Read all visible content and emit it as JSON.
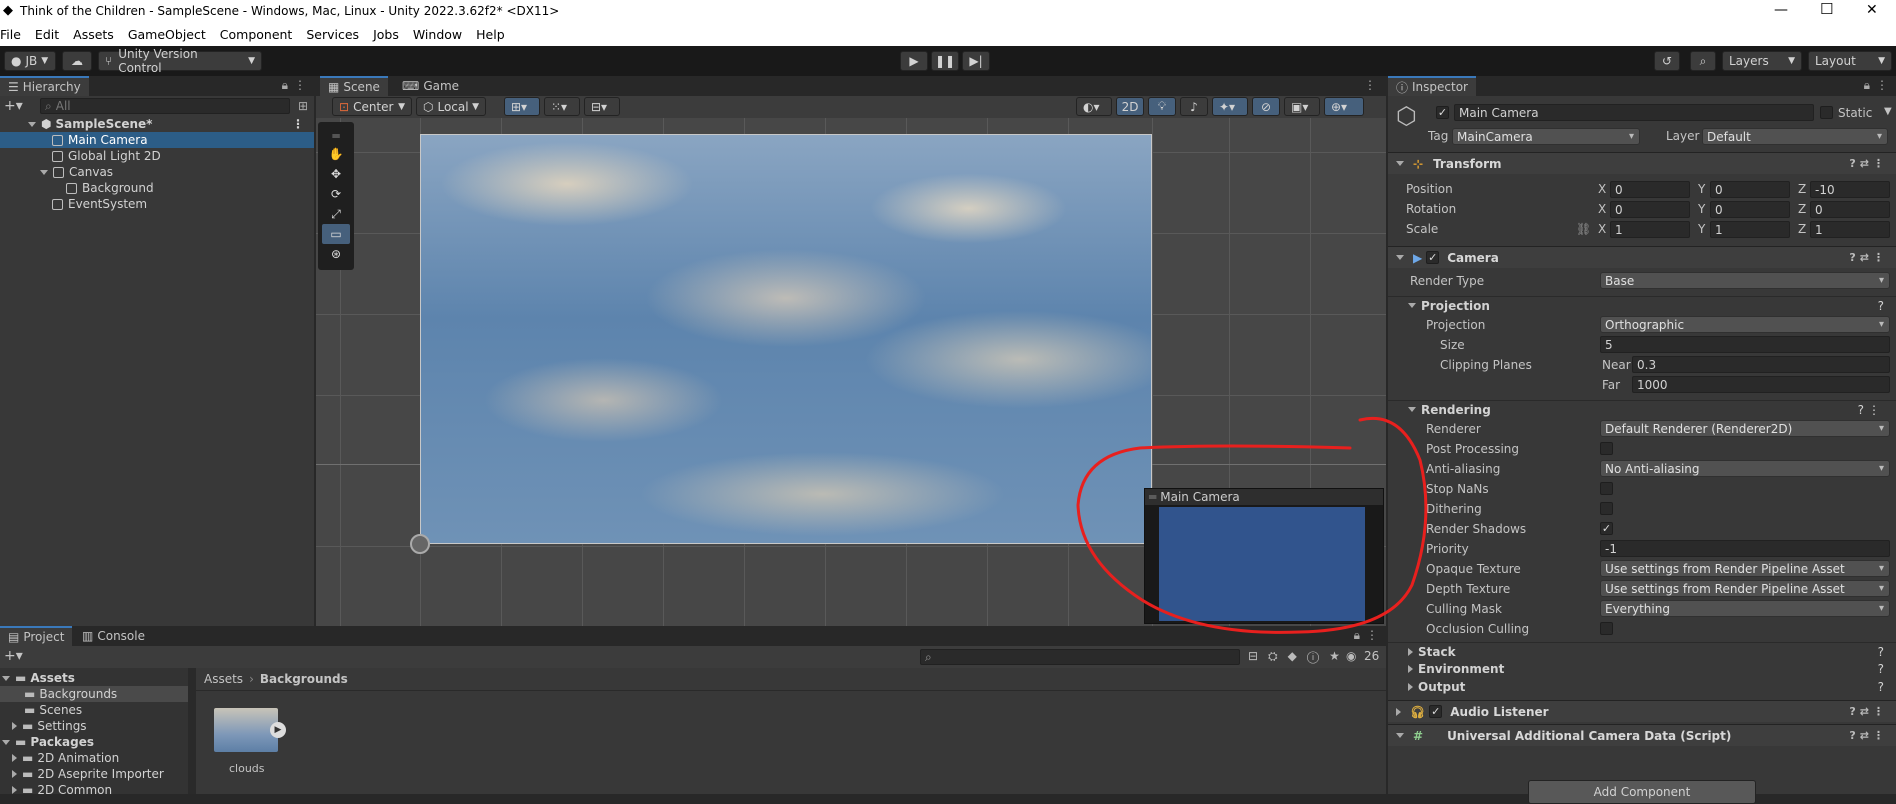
{
  "window": {
    "title": "Think of the Children - SampleScene - Windows, Mac, Linux - Unity 2022.3.62f2* <DX11>"
  },
  "menu": [
    "File",
    "Edit",
    "Assets",
    "GameObject",
    "Component",
    "Services",
    "Jobs",
    "Window",
    "Help"
  ],
  "toolbar": {
    "account": "JB",
    "version_control": "Unity Version Control",
    "layers": "Layers",
    "layout": "Layout"
  },
  "hierarchy": {
    "tab": "Hierarchy",
    "search_placeholder": "All",
    "scene": "SampleScene*",
    "items": [
      "Main Camera",
      "Global Light 2D",
      "Canvas",
      "Background",
      "EventSystem"
    ]
  },
  "scene_view": {
    "tabs": [
      "Scene",
      "Game"
    ],
    "pivot": "Center",
    "space": "Local",
    "mode_2d": "2D",
    "camera_preview_title": "Main Camera"
  },
  "inspector": {
    "tab": "Inspector",
    "object_name": "Main Camera",
    "static_label": "Static",
    "tag_label": "Tag",
    "tag": "MainCamera",
    "layer_label": "Layer",
    "layer": "Default",
    "transform": {
      "title": "Transform",
      "position_label": "Position",
      "rotation_label": "Rotation",
      "scale_label": "Scale",
      "position": [
        "0",
        "0",
        "-10"
      ],
      "rotation": [
        "0",
        "0",
        "0"
      ],
      "scale": [
        "1",
        "1",
        "1"
      ],
      "axes": [
        "X",
        "Y",
        "Z"
      ]
    },
    "camera": {
      "title": "Camera",
      "render_type_label": "Render Type",
      "render_type": "Base",
      "projection_header": "Projection",
      "projection_label": "Projection",
      "projection": "Orthographic",
      "size_label": "Size",
      "size": "5",
      "clipping_label": "Clipping Planes",
      "near_label": "Near",
      "near": "0.3",
      "far_label": "Far",
      "far": "1000",
      "rendering_header": "Rendering",
      "renderer_label": "Renderer",
      "renderer": "Default Renderer (Renderer2D)",
      "post_processing_label": "Post Processing",
      "anti_aliasing_label": "Anti-aliasing",
      "anti_aliasing": "No Anti-aliasing",
      "stop_nans_label": "Stop NaNs",
      "dithering_label": "Dithering",
      "render_shadows_label": "Render Shadows",
      "priority_label": "Priority",
      "priority": "-1",
      "opaque_texture_label": "Opaque Texture",
      "opaque_texture": "Use settings from Render Pipeline Asset",
      "depth_texture_label": "Depth Texture",
      "depth_texture": "Use settings from Render Pipeline Asset",
      "culling_mask_label": "Culling Mask",
      "culling_mask": "Everything",
      "occlusion_label": "Occlusion Culling",
      "stack_header": "Stack",
      "environment_header": "Environment",
      "output_header": "Output"
    },
    "audio_listener": "Audio Listener",
    "urp_data": "Universal Additional Camera Data (Script)",
    "add_component": "Add Component"
  },
  "project": {
    "tabs": [
      "Project",
      "Console"
    ],
    "visible_count": "26",
    "tree": {
      "assets": "Assets",
      "assets_children": [
        "Backgrounds",
        "Scenes",
        "Settings"
      ],
      "packages": "Packages",
      "packages_children": [
        "2D Animation",
        "2D Aseprite Importer",
        "2D Common"
      ]
    },
    "breadcrumb": [
      "Assets",
      "Backgrounds"
    ],
    "asset_name": "clouds"
  },
  "colors": {
    "selection": "#2c5d87",
    "accent": "#3a79bb",
    "annotation": "#e8201e"
  }
}
